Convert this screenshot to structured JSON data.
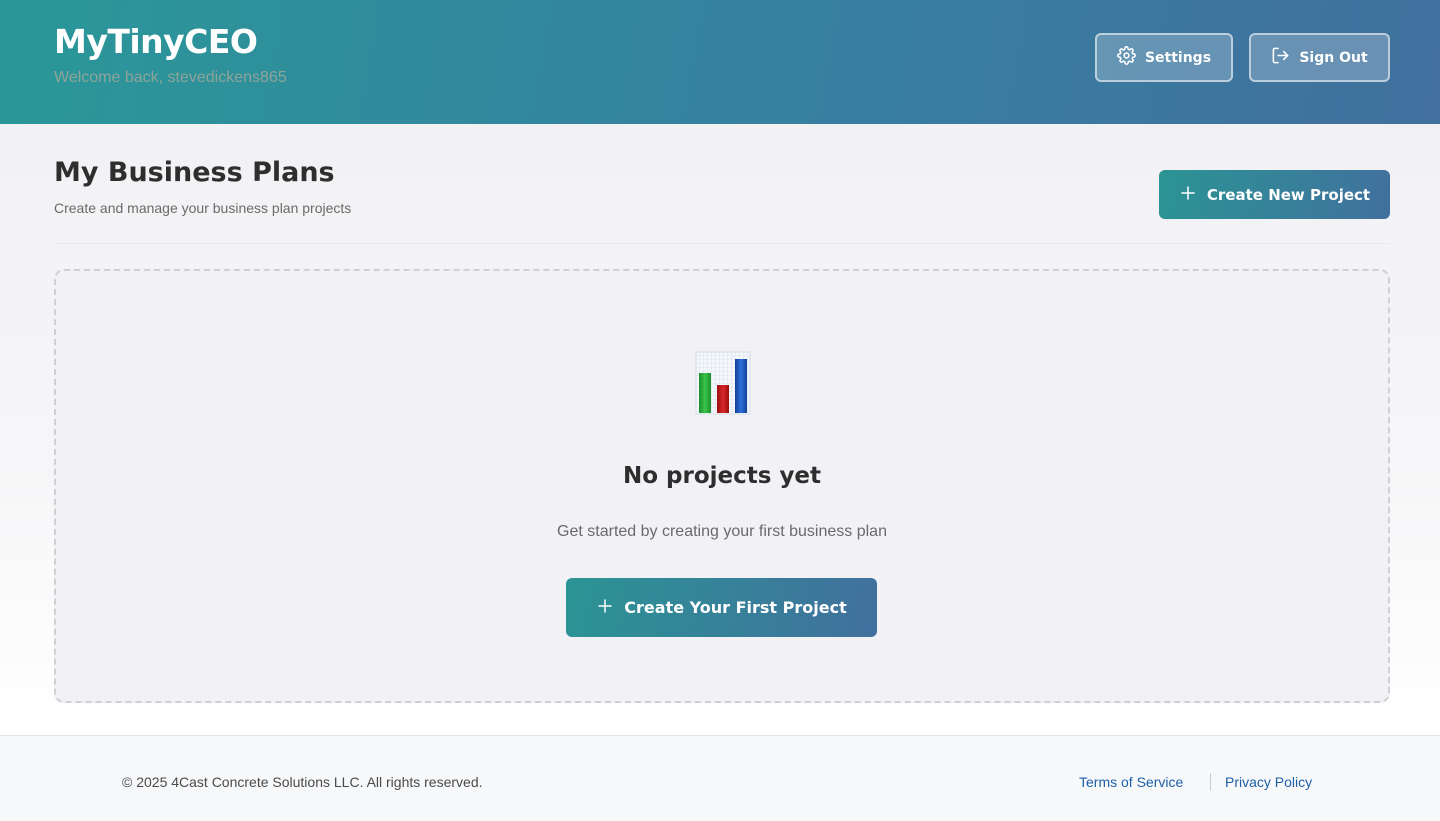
{
  "header": {
    "brand": "MyTinyCEO",
    "welcome": "Welcome back, stevedickens865",
    "settings_label": "Settings",
    "signout_label": "Sign Out",
    "settings_icon": "gear-icon",
    "signout_icon": "sign-out-icon"
  },
  "main": {
    "title": "My Business Plans",
    "subtitle": "Create and manage your business plan projects",
    "create_label": "Create New Project",
    "empty_state": {
      "icon": "bar-chart-icon",
      "title": "No projects yet",
      "description": "Get started by creating your first business plan",
      "button_label": "Create Your First Project"
    }
  },
  "footer": {
    "copyright": "© 2025 4Cast Concrete Solutions LLC. All rights reserved.",
    "terms_label": "Terms of Service",
    "privacy_label": "Privacy Policy"
  },
  "colors": {
    "header_gradient_start": "#2a9898",
    "header_gradient_end": "#41709e",
    "link": "#1f5fa8",
    "welcome_text": "#8ea49a"
  }
}
